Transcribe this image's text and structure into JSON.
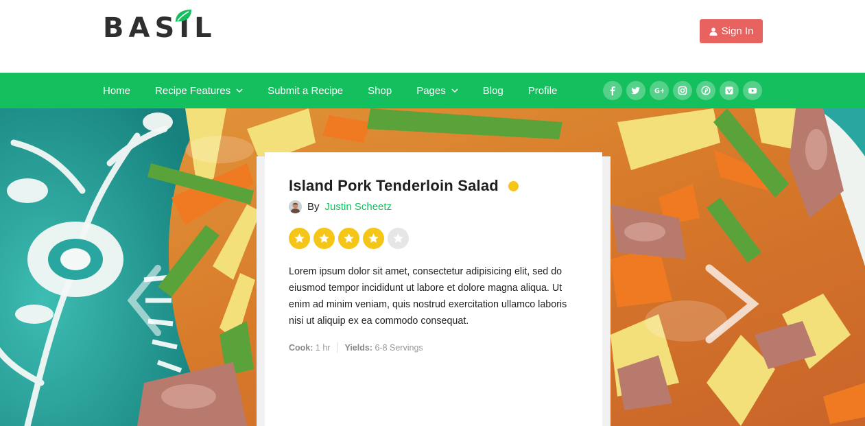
{
  "brand": {
    "logo_text": "BASIL",
    "accent": "#14c05e"
  },
  "header": {
    "signin_label": "Sign In",
    "signin_color": "#e8635f"
  },
  "nav": {
    "items": [
      {
        "label": "Home"
      },
      {
        "label": "Recipe Features",
        "dropdown": true
      },
      {
        "label": "Submit a Recipe"
      },
      {
        "label": "Shop"
      },
      {
        "label": "Pages",
        "dropdown": true
      },
      {
        "label": "Blog"
      },
      {
        "label": "Profile"
      }
    ],
    "socials": [
      "facebook-icon",
      "twitter-icon",
      "google-plus-icon",
      "instagram-icon",
      "pinterest-icon",
      "vimeo-icon",
      "youtube-icon"
    ]
  },
  "featured": {
    "title": "Island Pork Tenderloin Salad",
    "author_prefix": "By",
    "author": "Justin Scheetz",
    "rating": 4,
    "rating_max": 5,
    "description": "Lorem ipsum dolor sit amet, consectetur adipisicing elit, sed do eiusmod tempor incididunt ut labore et dolore magna aliqua. Ut enim ad minim veniam, quis nostrud exercitation ullamco laboris nisi ut aliquip ex ea commodo consequat.",
    "cook_label": "Cook:",
    "cook_value": "1 hr",
    "yields_label": "Yields:",
    "yields_value": "6-8 Servings"
  }
}
